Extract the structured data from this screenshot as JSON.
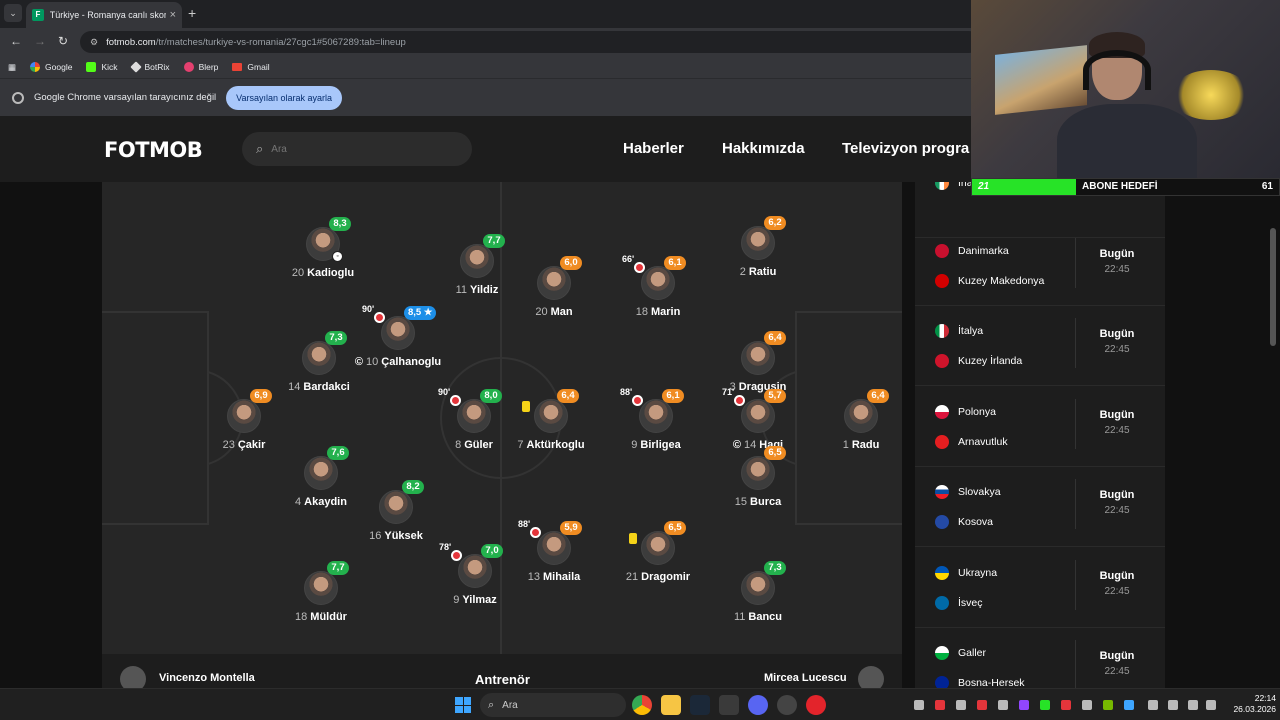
{
  "browser": {
    "tab_title": "Türkiye - Romanya canlı skor, ta",
    "url_host": "fotmob.com",
    "url_path": "/tr/matches/turkiye-vs-romania/27cgc1#5067289:tab=lineup",
    "bookmarks": [
      "Google",
      "Kick",
      "BotRix",
      "Blerp",
      "Gmail"
    ],
    "infobar_text": "Google Chrome varsayılan tarayıcınız değil",
    "infobar_button": "Varsayılan olarak ayarla"
  },
  "fotmob": {
    "logo": "FOTMOB",
    "search_placeholder": "Ara",
    "nav": [
      "Haberler",
      "Hakkımızda",
      "Televizyon progra"
    ]
  },
  "lineup": {
    "home": [
      {
        "num": "20",
        "name": "Kadioglu",
        "rating": "8,3",
        "color": "green",
        "ball": true
      },
      {
        "num": "11",
        "name": "Yildiz",
        "rating": "7,7",
        "color": "green"
      },
      {
        "num": "10",
        "name": "Çalhanoglu",
        "rating": "8,5 ★",
        "color": "blue",
        "minute": "90'",
        "sub": true,
        "captain": true
      },
      {
        "num": "14",
        "name": "Bardakci",
        "rating": "7,3",
        "color": "green"
      },
      {
        "num": "23",
        "name": "Çakir",
        "rating": "6,9",
        "color": "orange"
      },
      {
        "num": "8",
        "name": "Güler",
        "rating": "8,0",
        "color": "green",
        "minute": "90'",
        "sub": true
      },
      {
        "num": "7",
        "name": "Aktürkoglu",
        "rating": "6,4",
        "color": "orange",
        "yellow": true
      },
      {
        "num": "4",
        "name": "Akaydin",
        "rating": "7,6",
        "color": "green"
      },
      {
        "num": "16",
        "name": "Yüksek",
        "rating": "8,2",
        "color": "green"
      },
      {
        "num": "9",
        "name": "Yilmaz",
        "rating": "7,0",
        "color": "green",
        "minute": "78'",
        "sub": true
      },
      {
        "num": "18",
        "name": "Müldür",
        "rating": "7,7",
        "color": "green"
      }
    ],
    "away": [
      {
        "num": "20",
        "name": "Man",
        "rating": "6,0",
        "color": "orange"
      },
      {
        "num": "18",
        "name": "Marin",
        "rating": "6,1",
        "color": "orange",
        "minute": "66'",
        "sub": true
      },
      {
        "num": "2",
        "name": "Ratiu",
        "rating": "6,2",
        "color": "orange"
      },
      {
        "num": "3",
        "name": "Dragusin",
        "rating": "6,4",
        "color": "orange"
      },
      {
        "num": "9",
        "name": "Birligea",
        "rating": "6,1",
        "color": "orange",
        "minute": "88'",
        "sub": true
      },
      {
        "num": "14",
        "name": "Hagi",
        "rating": "5,7",
        "color": "orange",
        "minute": "71'",
        "sub": true,
        "captain": true
      },
      {
        "num": "1",
        "name": "Radu",
        "rating": "6,4",
        "color": "orange"
      },
      {
        "num": "15",
        "name": "Burca",
        "rating": "6,5",
        "color": "orange"
      },
      {
        "num": "13",
        "name": "Mihaila",
        "rating": "5,9",
        "color": "orange",
        "minute": "88'",
        "sub": true
      },
      {
        "num": "21",
        "name": "Dragomir",
        "rating": "6,5",
        "color": "orange",
        "yellow": true
      },
      {
        "num": "11",
        "name": "Bancu",
        "rating": "7,3",
        "color": "green"
      }
    ],
    "coach_label": "Antrenör",
    "home_coach": "Vincenzo Montella",
    "away_coach": "Mircea Lucescu"
  },
  "fixtures": [
    {
      "home": "Irla",
      "away": "",
      "day": "",
      "time": ""
    },
    {
      "home": "Danimarka",
      "away": "Kuzey Makedonya",
      "day": "Bugün",
      "time": "22:45"
    },
    {
      "home": "İtalya",
      "away": "Kuzey İrlanda",
      "day": "Bugün",
      "time": "22:45"
    },
    {
      "home": "Polonya",
      "away": "Arnavutluk",
      "day": "Bugün",
      "time": "22:45"
    },
    {
      "home": "Slovakya",
      "away": "Kosova",
      "day": "Bugün",
      "time": "22:45"
    },
    {
      "home": "Ukrayna",
      "away": "İsveç",
      "day": "Bugün",
      "time": "22:45"
    },
    {
      "home": "Galler",
      "away": "Bosna-Hersek",
      "day": "Bugün",
      "time": "22:45"
    }
  ],
  "overlay": {
    "sub_current": "21",
    "sub_label": "ABONE HEDEFİ",
    "sub_goal": "61",
    "sub_progress": 0.34
  },
  "taskbar": {
    "search": "Ara",
    "time": "22:14",
    "date": "26.03.2026"
  },
  "colors": {
    "rating_green": "#23b14d",
    "rating_orange": "#f08c22",
    "rating_blue": "#1d8fe8",
    "pitch": "#262626",
    "sub_bar": "#27e327"
  }
}
